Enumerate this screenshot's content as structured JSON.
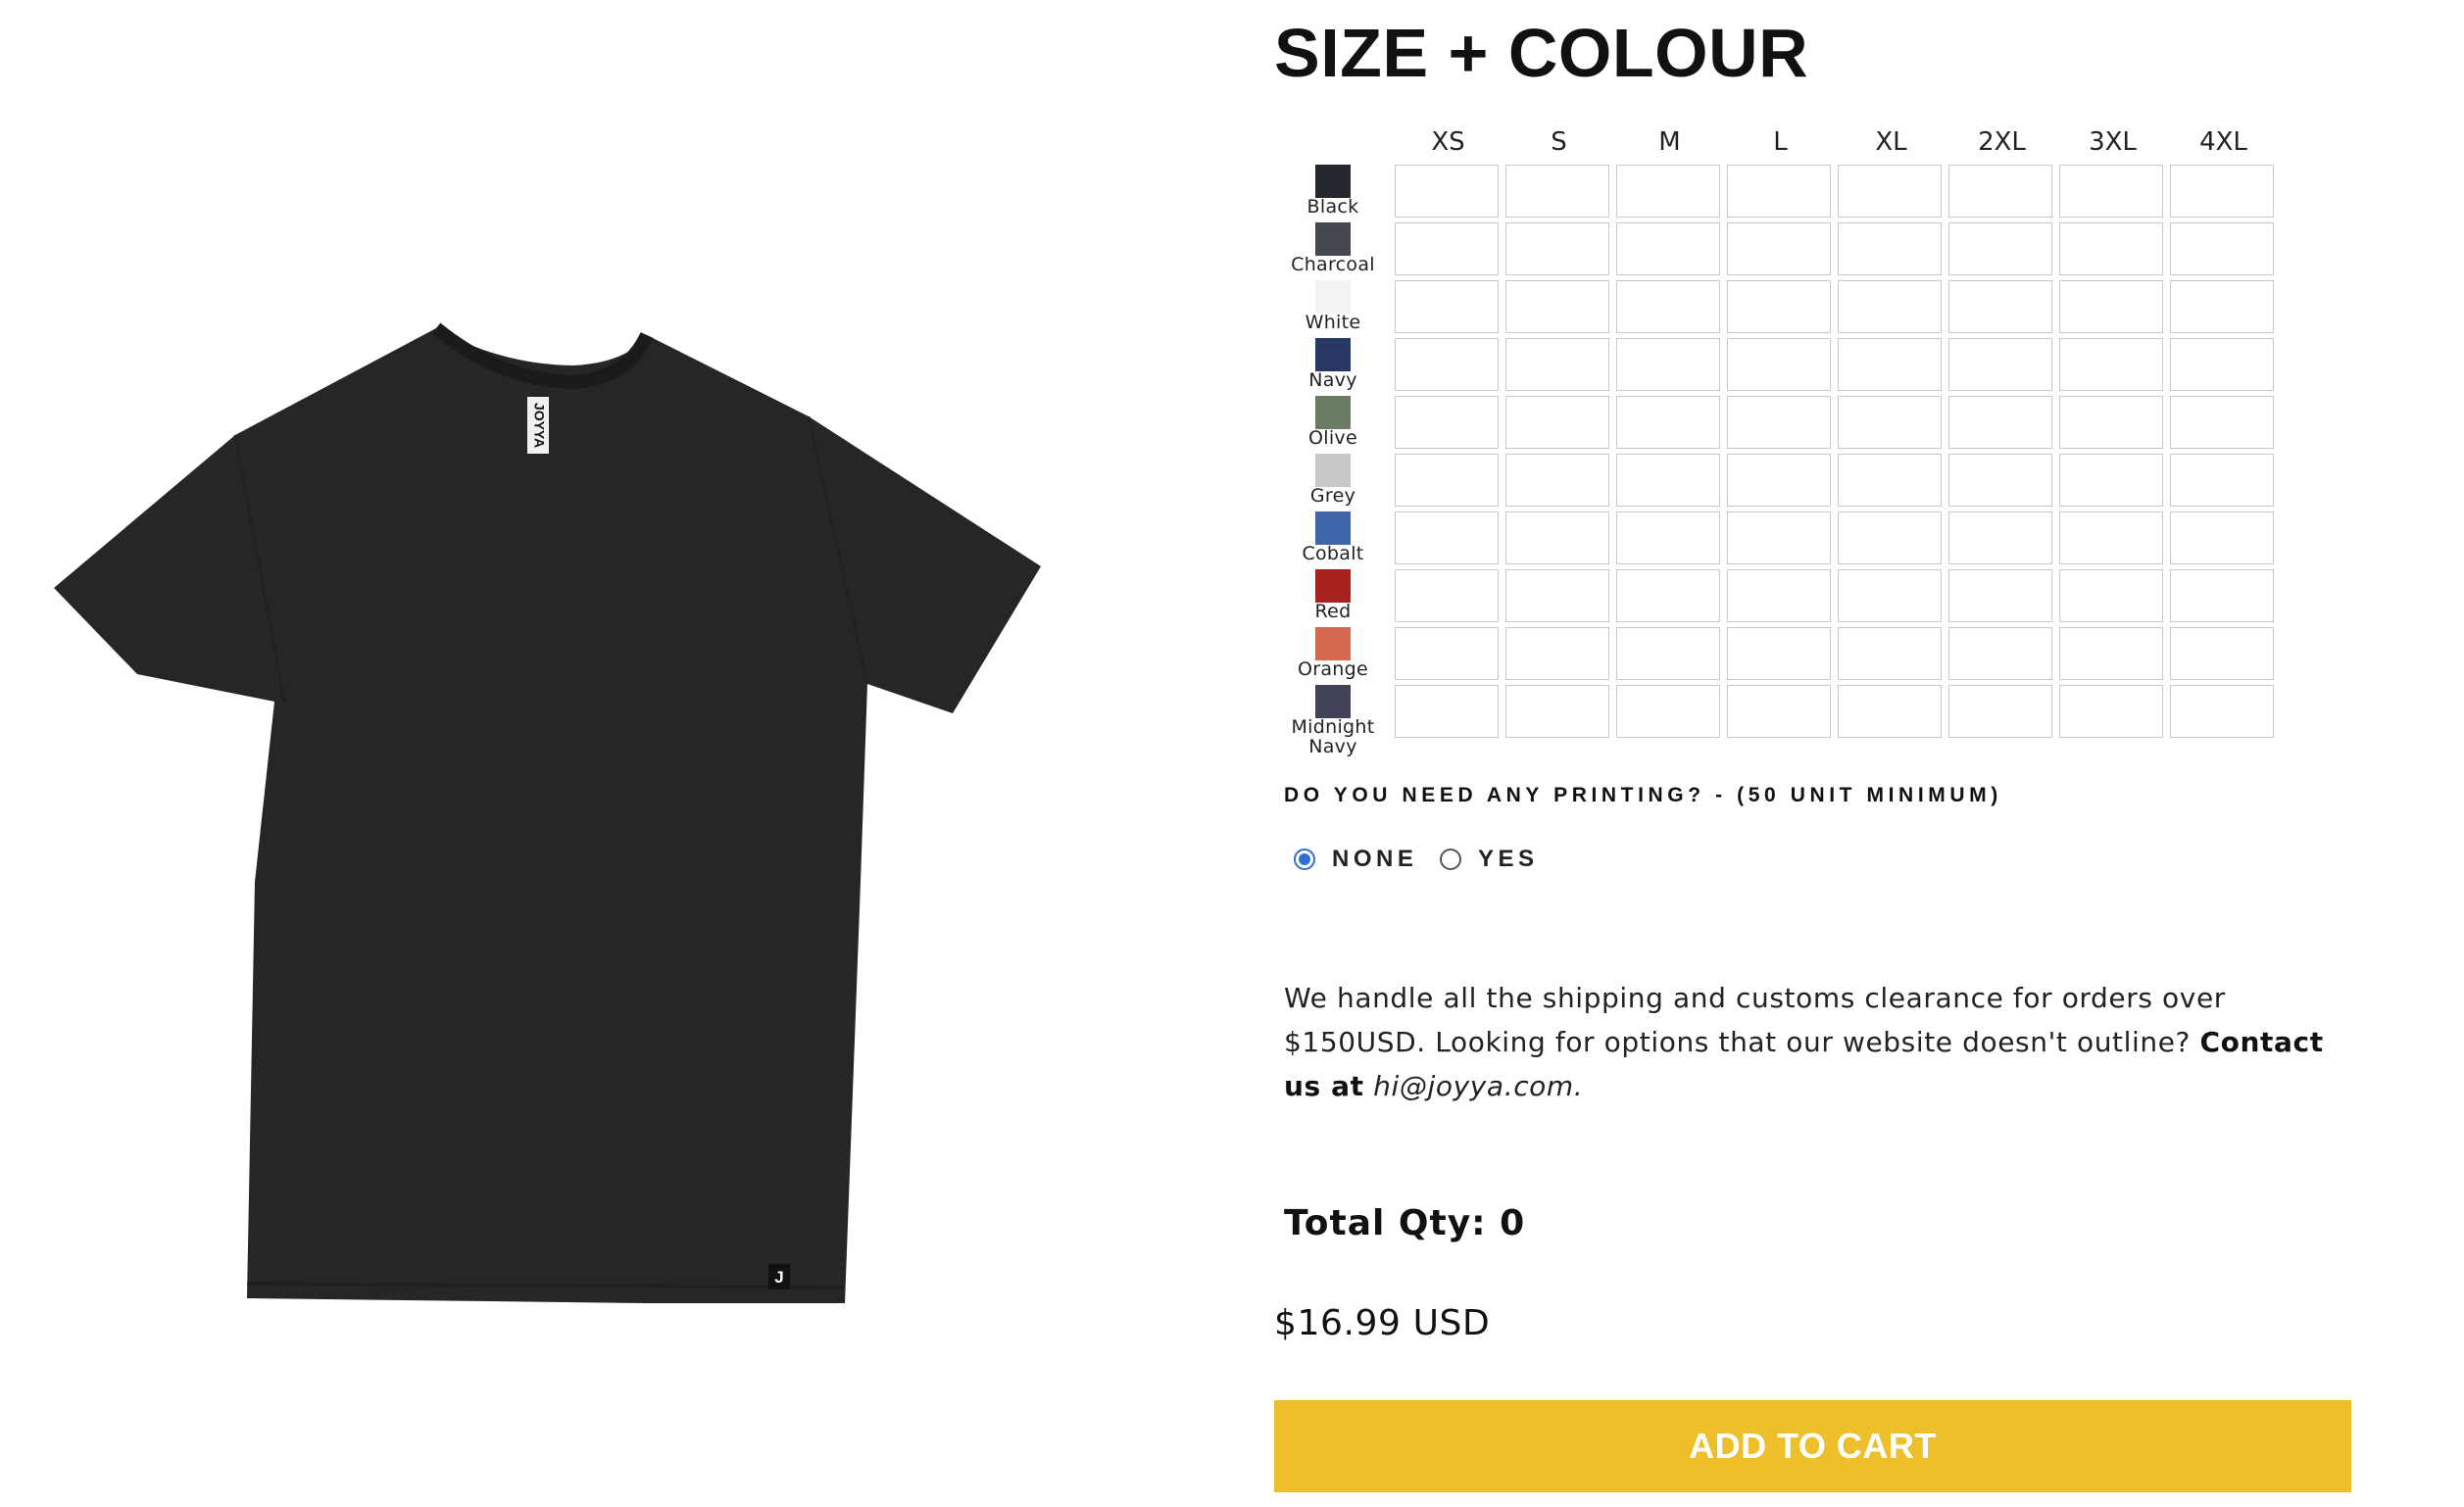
{
  "product": {
    "image_alt": "Black t-shirt",
    "neck_label_text": "JOYYA",
    "hem_tag_letter": "J"
  },
  "size_colour": {
    "title": "SIZE + COLOUR",
    "sizes": [
      "XS",
      "S",
      "M",
      "L",
      "XL",
      "2XL",
      "3XL",
      "4XL"
    ],
    "colors": [
      {
        "name": "Black",
        "hex": "#23262c"
      },
      {
        "name": "Charcoal",
        "hex": "#44474f"
      },
      {
        "name": "White",
        "hex": "#f3f3f3"
      },
      {
        "name": "Navy",
        "hex": "#273863"
      },
      {
        "name": "Olive",
        "hex": "#6a7c63"
      },
      {
        "name": "Grey",
        "hex": "#c9c9c9"
      },
      {
        "name": "Cobalt",
        "hex": "#4065a8"
      },
      {
        "name": "Red",
        "hex": "#a8211f"
      },
      {
        "name": "Orange",
        "hex": "#d76a4e"
      },
      {
        "name": "Midnight Navy",
        "hex": "#3f4258"
      }
    ]
  },
  "printing": {
    "question": "DO YOU NEED ANY PRINTING? - (50 UNIT MINIMUM)",
    "options": [
      {
        "label": "NONE",
        "selected": true
      },
      {
        "label": "YES",
        "selected": false
      }
    ]
  },
  "shipping": {
    "text_main": "We handle all the shipping and customs clearance for orders over $150USD. Looking for options that our website doesn't outline?",
    "contact_text": "Contact us at",
    "email": "hi@joyya.com."
  },
  "total_qty": "Total Qty: 0",
  "price": "$16.99 USD",
  "cart": {
    "add_label": "ADD TO CART"
  },
  "colors": {
    "accent_button": "#ecbf2b",
    "shirt": "#262626",
    "radio_selected": "#2f6fd6",
    "cell_border": "#c8c8c8"
  }
}
